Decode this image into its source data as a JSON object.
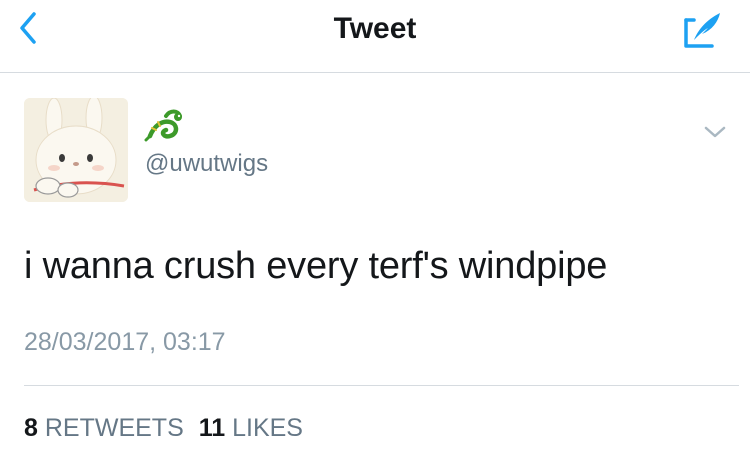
{
  "navbar": {
    "title": "Tweet",
    "back_icon": "chevron-left-icon",
    "compose_icon": "compose-quill-icon",
    "accent_color": "#1da1f2"
  },
  "tweet": {
    "display_name_icon": "dragon-emoji-icon",
    "handle": "@uwutwigs",
    "text": "i wanna crush every terf's windpipe",
    "timestamp": "28/03/2017, 03:17",
    "stats": {
      "retweets_count": "8",
      "retweets_label": "RETWEETS",
      "likes_count": "11",
      "likes_label": "LIKES"
    }
  },
  "colors": {
    "text_primary": "#14171a",
    "text_secondary": "#657786",
    "text_muted": "#8899a6",
    "divider": "#d6dbe0"
  }
}
